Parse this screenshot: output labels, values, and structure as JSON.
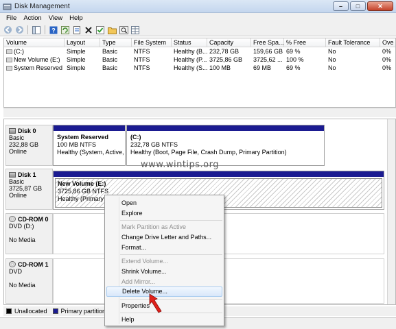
{
  "window": {
    "title": "Disk Management"
  },
  "menu": [
    "File",
    "Action",
    "View",
    "Help"
  ],
  "toolbar": {
    "icons": [
      "back-icon",
      "forward-icon",
      "console-tree-icon",
      "help-icon",
      "refresh-icon",
      "properties-icon",
      "delete-icon",
      "check-icon",
      "folder-icon",
      "search-icon",
      "grid-icon"
    ]
  },
  "volume_list": {
    "columns": [
      "Volume",
      "Layout",
      "Type",
      "File System",
      "Status",
      "Capacity",
      "Free Spa...",
      "% Free",
      "Fault Tolerance",
      "Ove"
    ],
    "rows": [
      [
        "(C:)",
        "Simple",
        "Basic",
        "NTFS",
        "Healthy (B...",
        "232,78 GB",
        "159,66 GB",
        "69 %",
        "No",
        "0%"
      ],
      [
        "New Volume (E:)",
        "Simple",
        "Basic",
        "NTFS",
        "Healthy (P...",
        "3725,86 GB",
        "3725,62 ...",
        "100 %",
        "No",
        "0%"
      ],
      [
        "System Reserved",
        "Simple",
        "Basic",
        "NTFS",
        "Healthy (S...",
        "100 MB",
        "69 MB",
        "69 %",
        "No",
        "0%"
      ]
    ]
  },
  "disks": [
    {
      "name": "Disk 0",
      "type": "Basic",
      "size": "232,88 GB",
      "status": "Online",
      "partitions": [
        {
          "name": "System Reserved",
          "size": "100 MB NTFS",
          "health": "Healthy (System, Active, Pr"
        },
        {
          "name": "(C:)",
          "size": "232,78 GB NTFS",
          "health": "Healthy (Boot, Page File, Crash Dump, Primary Partition)"
        }
      ]
    },
    {
      "name": "Disk 1",
      "type": "Basic",
      "size": "3725,87 GB",
      "status": "Online",
      "partitions": [
        {
          "name": "New Volume  (E:)",
          "size": "3725,86 GB NTFS",
          "health": "Healthy (Primary Pa"
        }
      ]
    },
    {
      "name": "CD-ROM 0",
      "type": "DVD (D:)",
      "status": "No Media"
    },
    {
      "name": "CD-ROM 1",
      "type": "DVD",
      "status": "No Media"
    }
  ],
  "legend": {
    "unallocated": "Unallocated",
    "primary": "Primary partition"
  },
  "watermark": "www.wintips.org",
  "context_menu": {
    "open": "Open",
    "explore": "Explore",
    "mark_active": "Mark Partition as Active",
    "change_letter": "Change Drive Letter and Paths...",
    "format": "Format...",
    "extend": "Extend Volume...",
    "shrink": "Shrink Volume...",
    "add_mirror": "Add Mirror...",
    "delete": "Delete Volume...",
    "properties": "Properties",
    "help": "Help"
  },
  "colors": {
    "primary_partition": "#1b1b91",
    "unallocated": "#000000",
    "selection": "#d8e7fa",
    "arrow": "#e0201b"
  }
}
